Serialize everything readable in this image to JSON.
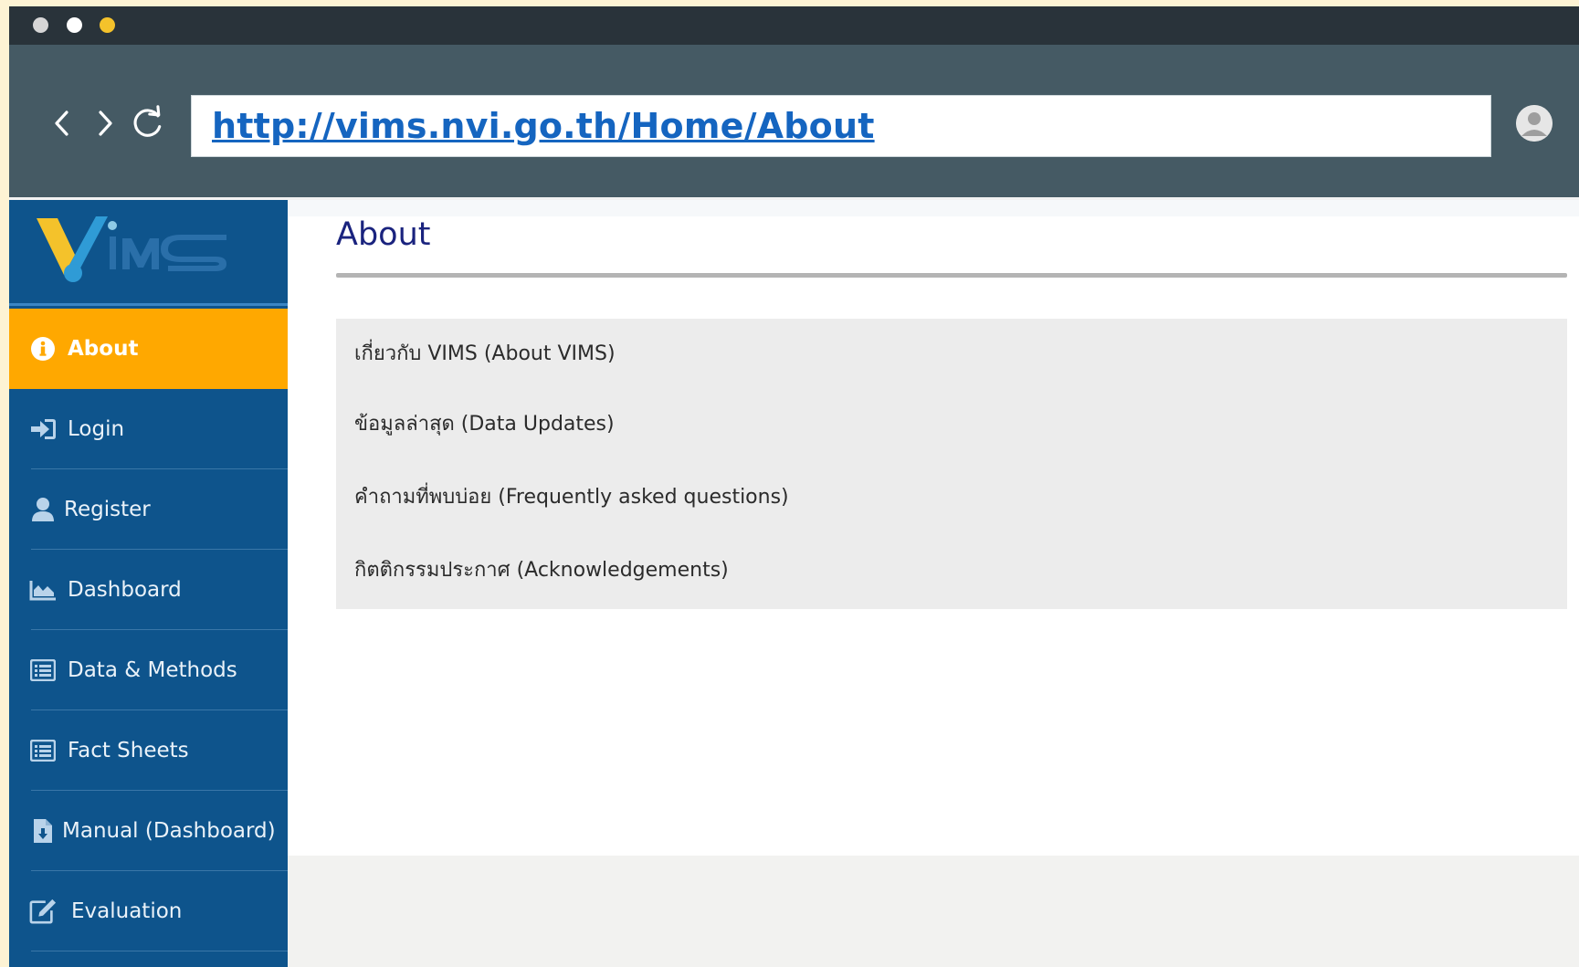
{
  "browser": {
    "url": "http://vims.nvi.go.th/Home/About",
    "back_icon": "chevron-left-icon",
    "forward_icon": "chevron-right-icon",
    "reload_icon": "reload-icon",
    "profile_icon": "user-avatar-icon"
  },
  "logo": {
    "text": "VIMS"
  },
  "sidebar": {
    "items": [
      {
        "label": "About",
        "icon": "info-icon",
        "active": true
      },
      {
        "label": "Login",
        "icon": "sign-in-icon"
      },
      {
        "label": "Register",
        "icon": "user-icon"
      },
      {
        "label": "Dashboard",
        "icon": "area-chart-icon"
      },
      {
        "label": "Data & Methods",
        "icon": "list-icon"
      },
      {
        "label": "Fact Sheets",
        "icon": "list-icon"
      },
      {
        "label": "Manual (Dashboard)",
        "icon": "file-download-icon"
      },
      {
        "label": "Evaluation",
        "icon": "edit-icon"
      }
    ]
  },
  "main": {
    "title": "About",
    "links": [
      "เกี่ยวกับ VIMS (About VIMS)",
      "ข้อมูลล่าสุด (Data Updates)",
      "คำถามที่พบบ่อย (Frequently asked questions)",
      "กิตติกรรมประกาศ (Acknowledgements)"
    ]
  },
  "colors": {
    "sidebar_bg": "#0e548c",
    "active_bg": "#ffa800",
    "title_color": "#1a237e",
    "url_color": "#1565c0"
  }
}
